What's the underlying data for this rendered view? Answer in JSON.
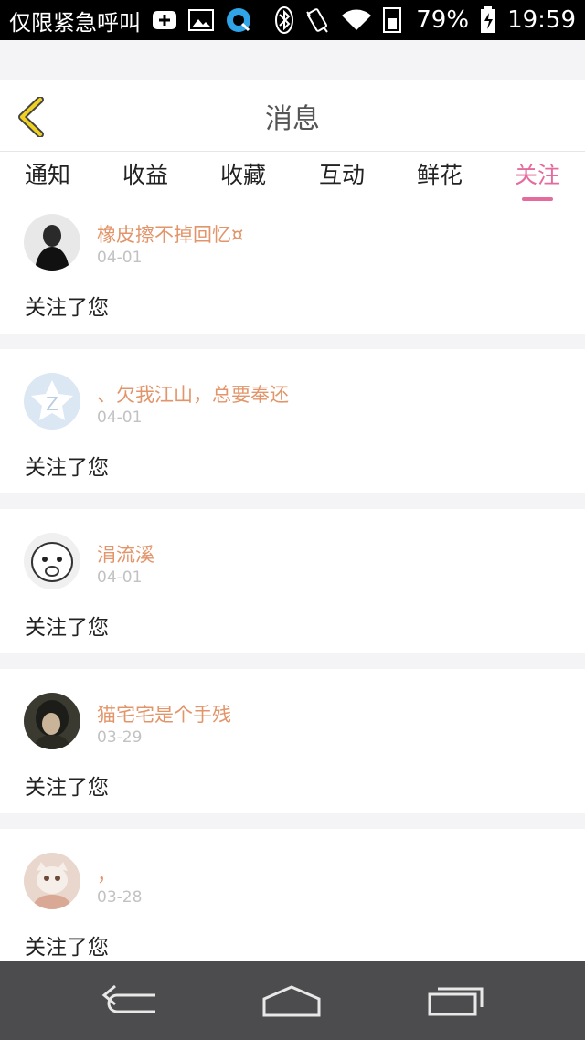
{
  "status_bar": {
    "label": "仅限紧急呼叫",
    "battery": "79%",
    "time": "19:59"
  },
  "header": {
    "title": "消息"
  },
  "tabs": [
    {
      "label": "通知",
      "active": false
    },
    {
      "label": "收益",
      "active": false
    },
    {
      "label": "收藏",
      "active": false
    },
    {
      "label": "互动",
      "active": false
    },
    {
      "label": "鲜花",
      "active": false
    },
    {
      "label": "关注",
      "active": true
    }
  ],
  "messages": [
    {
      "name": "橡皮擦不掉回忆¤",
      "date": "04-01",
      "text": "关注了您"
    },
    {
      "name": "、欠我江山，总要奉还",
      "date": "04-01",
      "text": "关注了您"
    },
    {
      "name": "涓流溪",
      "date": "04-01",
      "text": "关注了您"
    },
    {
      "name": "猫宅宅是个手残",
      "date": "03-29",
      "text": "关注了您"
    },
    {
      "name": "，",
      "date": "03-28",
      "text": "关注了您"
    }
  ],
  "colors": {
    "accent": "#e56b9e",
    "name": "#e2956a",
    "back_arrow": "#f0d020"
  }
}
